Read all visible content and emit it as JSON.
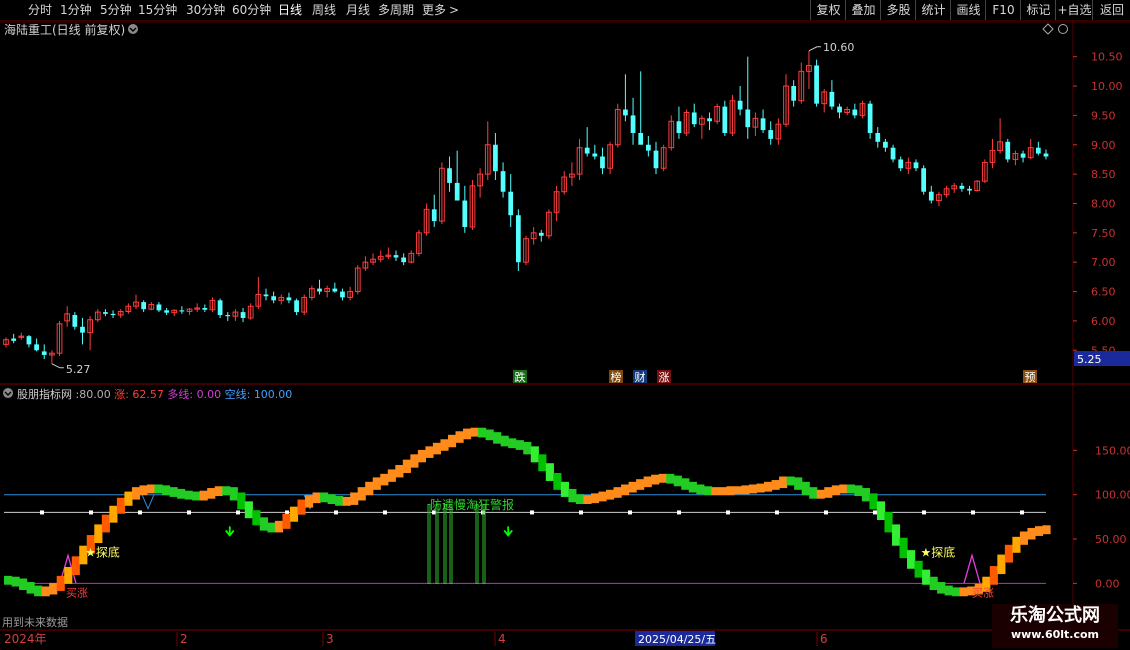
{
  "toolbar": {
    "periods": [
      "分时",
      "1分钟",
      "5分钟",
      "15分钟",
      "30分钟",
      "60分钟",
      "日线",
      "周线",
      "月线",
      "多周期",
      "更多"
    ],
    "active_period": "日线",
    "more_arrow": ">",
    "right_buttons": [
      "复权",
      "叠加",
      "多股",
      "统计",
      "画线",
      "F10",
      "标记",
      "+自选",
      "返回"
    ]
  },
  "colors": {
    "up": "#ff3d3d",
    "down": "#54ffff",
    "grid": "#5a0000",
    "axis_text": "#c83232",
    "line_100": "#2f8cd8",
    "line_80": "#cfcfcf",
    "line_0": "#c030c0",
    "accent_green": "#00ff00"
  },
  "price_panel": {
    "title": "海陆重工(日线 前复权)",
    "high_label": "10.60",
    "low_label": "5.27",
    "current_price": "5.25",
    "markers": [
      {
        "text": "跌",
        "bg": "#1a6a1a",
        "color": "#ffffff",
        "x": 520
      },
      {
        "text": "榜",
        "bg": "#7a4a10",
        "color": "#ffffff",
        "x": 616
      },
      {
        "text": "财",
        "bg": "#103a7a",
        "color": "#ffffff",
        "x": 640
      },
      {
        "text": "涨",
        "bg": "#7a1010",
        "color": "#ffffff",
        "x": 664
      },
      {
        "text": "预",
        "bg": "#8a5010",
        "color": "#ffffff",
        "x": 1030
      }
    ]
  },
  "indicator_panel": {
    "title": "股朋指标网",
    "v_title": "80.00",
    "zhang_label": "涨:",
    "zhang_value": "62.57",
    "duo_label": "多线:",
    "duo_value": "0.00",
    "kong_label": "空线:",
    "kong_value": "100.00",
    "tanzi": "★探底",
    "warning": "防遗慢淘狂警报",
    "buy_label": "买涨",
    "footer_note": "用到未来数据"
  },
  "timeline": {
    "year_label": "2024年",
    "months": [
      "2",
      "3",
      "4",
      "6"
    ],
    "cursor_date": "2025/04/25/五"
  },
  "watermark": {
    "name": "乐淘公式网",
    "url": "www.60lt.com"
  },
  "chart_data": {
    "type": "candlestick",
    "title": "海陆重工(日线 前复权)",
    "y_ticks": [
      "10.50",
      "10.00",
      "9.50",
      "9.00",
      "8.50",
      "8.00",
      "7.50",
      "7.00",
      "6.50",
      "6.00",
      "5.50"
    ],
    "ylim": [
      5.3,
      10.75
    ],
    "high_mark": 10.6,
    "low_mark": 5.27,
    "ohlc": [
      [
        5.6,
        5.72,
        5.55,
        5.68
      ],
      [
        5.7,
        5.78,
        5.62,
        5.66
      ],
      [
        5.72,
        5.8,
        5.68,
        5.74
      ],
      [
        5.74,
        5.76,
        5.55,
        5.6
      ],
      [
        5.6,
        5.7,
        5.48,
        5.5
      ],
      [
        5.48,
        5.6,
        5.35,
        5.42
      ],
      [
        5.42,
        5.5,
        5.27,
        5.45
      ],
      [
        5.45,
        6.0,
        5.4,
        5.95
      ],
      [
        6.0,
        6.25,
        5.9,
        6.12
      ],
      [
        6.1,
        6.15,
        5.85,
        5.9
      ],
      [
        5.9,
        6.05,
        5.6,
        5.8
      ],
      [
        5.8,
        6.08,
        5.5,
        6.02
      ],
      [
        6.02,
        6.2,
        5.98,
        6.15
      ],
      [
        6.15,
        6.2,
        6.08,
        6.12
      ],
      [
        6.12,
        6.18,
        6.05,
        6.1
      ],
      [
        6.1,
        6.2,
        6.05,
        6.16
      ],
      [
        6.16,
        6.3,
        6.12,
        6.25
      ],
      [
        6.25,
        6.45,
        6.2,
        6.32
      ],
      [
        6.32,
        6.35,
        6.15,
        6.2
      ],
      [
        6.2,
        6.32,
        6.18,
        6.28
      ],
      [
        6.28,
        6.32,
        6.15,
        6.18
      ],
      [
        6.18,
        6.22,
        6.1,
        6.14
      ],
      [
        6.14,
        6.2,
        6.08,
        6.18
      ],
      [
        6.18,
        6.25,
        6.12,
        6.16
      ],
      [
        6.16,
        6.22,
        6.1,
        6.2
      ],
      [
        6.2,
        6.3,
        6.15,
        6.22
      ],
      [
        6.22,
        6.28,
        6.15,
        6.19
      ],
      [
        6.19,
        6.4,
        6.15,
        6.35
      ],
      [
        6.35,
        6.38,
        6.05,
        6.1
      ],
      [
        6.1,
        6.15,
        6.0,
        6.08
      ],
      [
        6.08,
        6.2,
        6.0,
        6.15
      ],
      [
        6.15,
        6.22,
        5.98,
        6.05
      ],
      [
        6.05,
        6.3,
        6.02,
        6.25
      ],
      [
        6.25,
        6.75,
        6.2,
        6.45
      ],
      [
        6.45,
        6.55,
        6.35,
        6.42
      ],
      [
        6.42,
        6.5,
        6.3,
        6.35
      ],
      [
        6.35,
        6.45,
        6.28,
        6.4
      ],
      [
        6.4,
        6.48,
        6.3,
        6.35
      ],
      [
        6.35,
        6.38,
        6.1,
        6.15
      ],
      [
        6.15,
        6.45,
        6.1,
        6.4
      ],
      [
        6.4,
        6.6,
        6.35,
        6.55
      ],
      [
        6.55,
        6.7,
        6.45,
        6.5
      ],
      [
        6.5,
        6.6,
        6.4,
        6.55
      ],
      [
        6.55,
        6.65,
        6.48,
        6.5
      ],
      [
        6.5,
        6.55,
        6.35,
        6.4
      ],
      [
        6.4,
        6.58,
        6.35,
        6.5
      ],
      [
        6.5,
        6.95,
        6.45,
        6.9
      ],
      [
        6.9,
        7.1,
        6.85,
        7.0
      ],
      [
        7.0,
        7.15,
        6.95,
        7.05
      ],
      [
        7.05,
        7.2,
        7.0,
        7.1
      ],
      [
        7.1,
        7.25,
        7.05,
        7.12
      ],
      [
        7.12,
        7.2,
        7.02,
        7.08
      ],
      [
        7.08,
        7.15,
        6.95,
        7.0
      ],
      [
        7.0,
        7.2,
        6.98,
        7.15
      ],
      [
        7.15,
        7.55,
        7.1,
        7.5
      ],
      [
        7.5,
        8.0,
        7.45,
        7.9
      ],
      [
        7.9,
        8.15,
        7.6,
        7.7
      ],
      [
        7.7,
        8.7,
        7.65,
        8.6
      ],
      [
        8.6,
        8.8,
        8.2,
        8.35
      ],
      [
        8.35,
        8.9,
        8.3,
        8.05
      ],
      [
        8.05,
        8.3,
        7.5,
        7.6
      ],
      [
        7.6,
        8.4,
        7.55,
        8.3
      ],
      [
        8.3,
        8.6,
        8.1,
        8.5
      ],
      [
        8.5,
        9.4,
        8.4,
        9.0
      ],
      [
        9.0,
        9.2,
        8.4,
        8.55
      ],
      [
        8.55,
        8.7,
        8.1,
        8.2
      ],
      [
        8.2,
        8.5,
        7.6,
        7.8
      ],
      [
        7.8,
        7.9,
        6.85,
        7.0
      ],
      [
        7.0,
        7.45,
        6.95,
        7.4
      ],
      [
        7.4,
        7.6,
        7.3,
        7.5
      ],
      [
        7.5,
        7.55,
        7.35,
        7.45
      ],
      [
        7.45,
        7.9,
        7.4,
        7.85
      ],
      [
        7.85,
        8.3,
        7.7,
        8.2
      ],
      [
        8.2,
        8.55,
        8.15,
        8.45
      ],
      [
        8.45,
        8.7,
        8.3,
        8.5
      ],
      [
        8.5,
        9.1,
        8.4,
        8.95
      ],
      [
        8.95,
        9.3,
        8.8,
        8.85
      ],
      [
        8.85,
        9.0,
        8.75,
        8.8
      ],
      [
        8.8,
        8.95,
        8.5,
        8.6
      ],
      [
        8.6,
        9.05,
        8.5,
        9.0
      ],
      [
        9.0,
        9.7,
        8.95,
        9.6
      ],
      [
        9.6,
        10.2,
        9.4,
        9.5
      ],
      [
        9.5,
        9.8,
        9.0,
        9.2
      ],
      [
        9.2,
        10.25,
        9.1,
        9.0
      ],
      [
        9.0,
        9.15,
        8.8,
        8.9
      ],
      [
        8.9,
        9.05,
        8.5,
        8.6
      ],
      [
        8.6,
        9.0,
        8.55,
        8.95
      ],
      [
        8.95,
        9.5,
        8.9,
        9.4
      ],
      [
        9.4,
        9.65,
        9.1,
        9.2
      ],
      [
        9.2,
        9.6,
        9.15,
        9.55
      ],
      [
        9.55,
        9.7,
        9.3,
        9.35
      ],
      [
        9.35,
        9.5,
        9.1,
        9.45
      ],
      [
        9.45,
        9.55,
        9.25,
        9.4
      ],
      [
        9.4,
        9.7,
        9.35,
        9.65
      ],
      [
        9.65,
        9.75,
        9.15,
        9.2
      ],
      [
        9.2,
        9.85,
        9.15,
        9.75
      ],
      [
        9.75,
        10.0,
        9.5,
        9.6
      ],
      [
        9.6,
        10.5,
        9.1,
        9.3
      ],
      [
        9.3,
        9.55,
        9.15,
        9.45
      ],
      [
        9.45,
        9.6,
        9.2,
        9.25
      ],
      [
        9.25,
        9.4,
        9.0,
        9.1
      ],
      [
        9.1,
        9.45,
        9.0,
        9.35
      ],
      [
        9.35,
        10.2,
        9.3,
        10.0
      ],
      [
        10.0,
        10.1,
        9.65,
        9.75
      ],
      [
        9.75,
        10.4,
        9.7,
        10.25
      ],
      [
        10.25,
        10.6,
        9.95,
        10.35
      ],
      [
        10.35,
        10.45,
        9.65,
        9.7
      ],
      [
        9.7,
        9.95,
        9.55,
        9.9
      ],
      [
        9.9,
        10.1,
        9.6,
        9.65
      ],
      [
        9.65,
        9.7,
        9.45,
        9.55
      ],
      [
        9.55,
        9.65,
        9.5,
        9.6
      ],
      [
        9.6,
        9.7,
        9.45,
        9.5
      ],
      [
        9.5,
        9.75,
        9.45,
        9.7
      ],
      [
        9.7,
        9.75,
        9.1,
        9.2
      ],
      [
        9.2,
        9.3,
        8.95,
        9.05
      ],
      [
        9.05,
        9.1,
        8.88,
        8.95
      ],
      [
        8.95,
        9.0,
        8.7,
        8.75
      ],
      [
        8.75,
        8.8,
        8.55,
        8.6
      ],
      [
        8.6,
        8.78,
        8.5,
        8.7
      ],
      [
        8.7,
        8.75,
        8.55,
        8.6
      ],
      [
        8.6,
        8.65,
        8.15,
        8.2
      ],
      [
        8.2,
        8.3,
        8.0,
        8.05
      ],
      [
        8.05,
        8.2,
        7.95,
        8.15
      ],
      [
        8.15,
        8.3,
        8.1,
        8.25
      ],
      [
        8.25,
        8.35,
        8.18,
        8.3
      ],
      [
        8.3,
        8.35,
        8.2,
        8.25
      ],
      [
        8.25,
        8.3,
        8.15,
        8.22
      ],
      [
        8.22,
        8.4,
        8.2,
        8.38
      ],
      [
        8.38,
        8.75,
        8.35,
        8.7
      ],
      [
        8.7,
        9.1,
        8.6,
        8.9
      ],
      [
        8.9,
        9.45,
        8.85,
        9.05
      ],
      [
        9.05,
        9.1,
        8.7,
        8.75
      ],
      [
        8.75,
        8.9,
        8.65,
        8.85
      ],
      [
        8.85,
        8.9,
        8.7,
        8.78
      ],
      [
        8.78,
        9.1,
        8.75,
        8.95
      ],
      [
        8.95,
        9.05,
        8.82,
        8.85
      ],
      [
        8.85,
        8.92,
        8.75,
        8.8
      ]
    ],
    "indicator": {
      "y_ticks": [
        "150.00",
        "100.00",
        "50.00",
        "0.00"
      ],
      "ylim": [
        -30,
        200
      ],
      "ref_lines": [
        100,
        80,
        0
      ],
      "band": [
        4,
        3,
        1,
        -3,
        -7,
        -10,
        -8,
        -4,
        4,
        14,
        26,
        38,
        50,
        62,
        73,
        83,
        92,
        99,
        104,
        106,
        107,
        106,
        104,
        102,
        100,
        99,
        98,
        100,
        103,
        105,
        104,
        98,
        88,
        78,
        70,
        64,
        62,
        66,
        74,
        82,
        90,
        95,
        98,
        96,
        94,
        92,
        93,
        98,
        104,
        110,
        115,
        119,
        124,
        129,
        135,
        141,
        146,
        150,
        154,
        158,
        163,
        167,
        170,
        171,
        169,
        166,
        162,
        159,
        157,
        155,
        150,
        141,
        131,
        120,
        110,
        102,
        96,
        94,
        95,
        97,
        99,
        101,
        104,
        107,
        110,
        113,
        116,
        118,
        119,
        117,
        114,
        110,
        107,
        105,
        104,
        104,
        104,
        105,
        105,
        106,
        107,
        108,
        110,
        112,
        116,
        115,
        110,
        104,
        100,
        101,
        104,
        106,
        107,
        106,
        103,
        97,
        88,
        76,
        62,
        47,
        33,
        21,
        11,
        3,
        -3,
        -7,
        -9,
        -10,
        -9,
        -8,
        -5,
        3,
        15,
        28,
        39,
        48,
        54,
        58,
        60,
        61
      ],
      "down_arrows": [
        30,
        67
      ],
      "tanzi_points": [
        6,
        117,
        191
      ]
    }
  }
}
